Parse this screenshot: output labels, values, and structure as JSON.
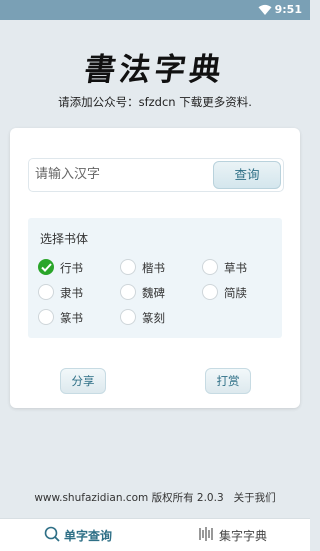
{
  "status_bar": {
    "time": "9:51"
  },
  "header": {
    "app_title": "書法字典",
    "subtitle": "请添加公众号：sfzdcn 下载更多资料."
  },
  "search": {
    "placeholder": "请输入汉字",
    "value": "",
    "button_label": "查询"
  },
  "font_select": {
    "title": "选择书体",
    "options": [
      {
        "label": "行书",
        "checked": true
      },
      {
        "label": "楷书",
        "checked": false
      },
      {
        "label": "草书",
        "checked": false
      },
      {
        "label": "隶书",
        "checked": false
      },
      {
        "label": "魏碑",
        "checked": false
      },
      {
        "label": "简牍",
        "checked": false
      },
      {
        "label": "篆书",
        "checked": false
      },
      {
        "label": "篆刻",
        "checked": false
      }
    ]
  },
  "actions": {
    "share_label": "分享",
    "reward_label": "打赏"
  },
  "footer": {
    "copyright": "www.shufazidian.com 版权所有 2.0.3",
    "about_label": "关于我们"
  },
  "tabs": [
    {
      "label": "单字查询",
      "icon": "search-icon",
      "active": true
    },
    {
      "label": "集字字典",
      "icon": "barcode-icon",
      "active": false
    }
  ],
  "colors": {
    "accent": "#2e6f86",
    "check": "#2aa52a",
    "status_bar": "#7aa0b5"
  }
}
